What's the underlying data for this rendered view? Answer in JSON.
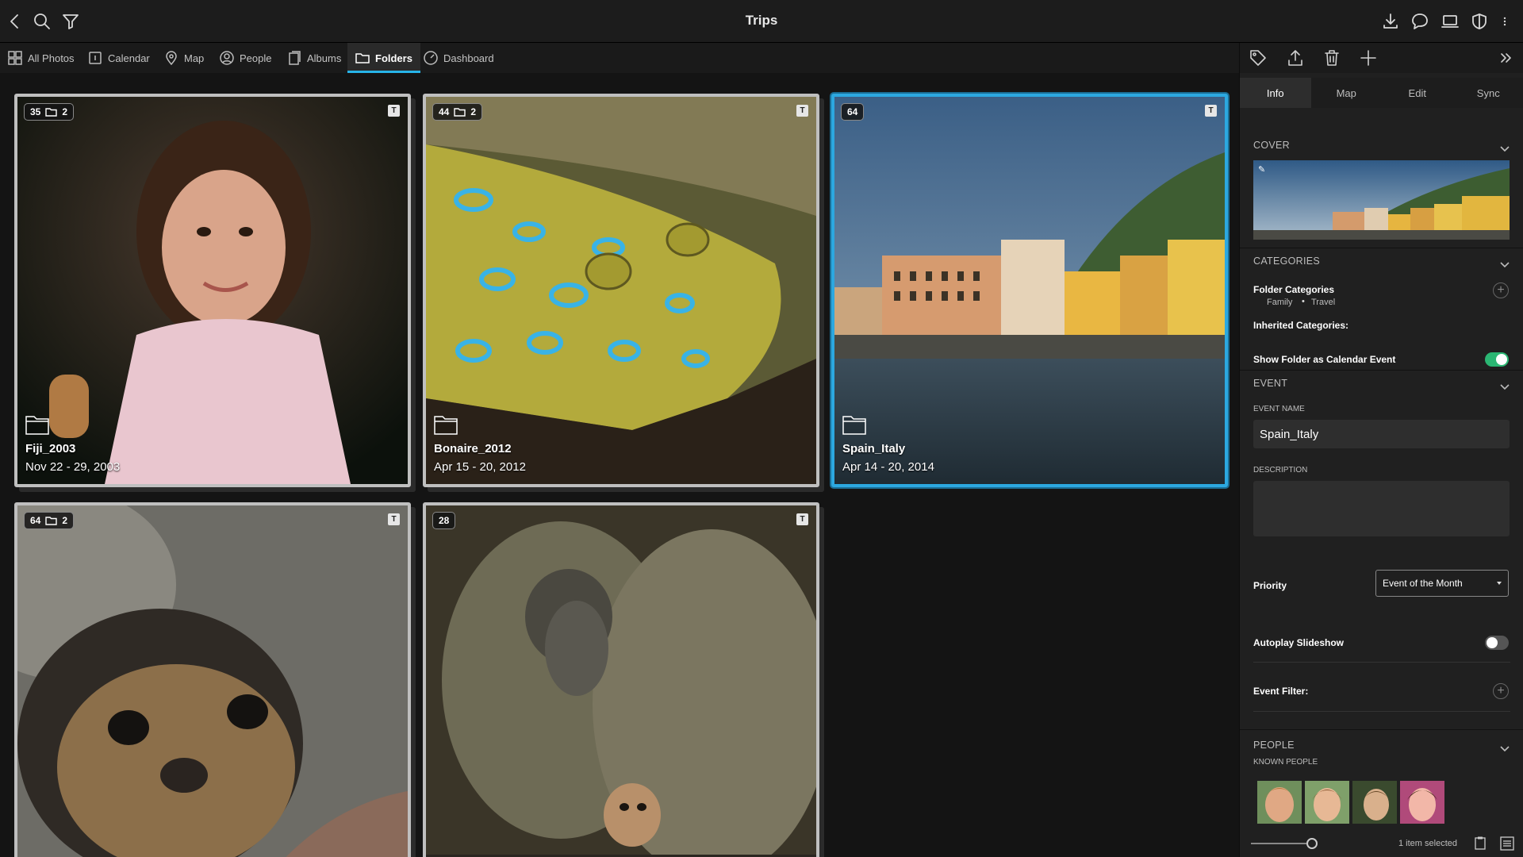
{
  "window": {
    "title": "Trips"
  },
  "nav": {
    "tabs": [
      {
        "label": "All Photos",
        "icon": "grid-icon"
      },
      {
        "label": "Calendar",
        "icon": "calendar-icon"
      },
      {
        "label": "Map",
        "icon": "map-pin-icon"
      },
      {
        "label": "People",
        "icon": "person-icon"
      },
      {
        "label": "Albums",
        "icon": "album-icon"
      },
      {
        "label": "Folders",
        "icon": "folder-icon",
        "active": true
      },
      {
        "label": "Dashboard",
        "icon": "gauge-icon"
      }
    ]
  },
  "folders": [
    {
      "name": "Fiji_2003",
      "dates": "Nov 22 - 29, 2003",
      "count": "35",
      "subfolders": "2",
      "selected": false
    },
    {
      "name": "Bonaire_2012",
      "dates": "Apr 15 - 20, 2012",
      "count": "44",
      "subfolders": "2",
      "selected": false
    },
    {
      "name": "Spain_Italy",
      "dates": "Apr 14 - 20, 2014",
      "count": "64",
      "subfolders": "",
      "selected": true
    },
    {
      "name": "",
      "dates": "",
      "count": "64",
      "subfolders": "2",
      "selected": false
    },
    {
      "name": "",
      "dates": "",
      "count": "28",
      "subfolders": "",
      "selected": false
    }
  ],
  "tile_badge": "T",
  "panel": {
    "tabs": [
      {
        "label": "Info",
        "active": true
      },
      {
        "label": "Map"
      },
      {
        "label": "Edit"
      },
      {
        "label": "Sync"
      }
    ],
    "cover_header": "COVER",
    "categories_header": "CATEGORIES",
    "folder_categories_label": "Folder Categories",
    "folder_categories_values": [
      "Family",
      "Travel"
    ],
    "inherited_categories_label": "Inherited Categories:",
    "show_calendar_label": "Show Folder as Calendar Event",
    "show_calendar_on": true,
    "event_header": "EVENT",
    "event_name_label": "EVENT NAME",
    "event_name_value": "Spain_Italy",
    "description_label": "DESCRIPTION",
    "description_value": "",
    "priority_label": "Priority",
    "priority_value": "Event of the Month",
    "autoplay_label": "Autoplay Slideshow",
    "autoplay_on": false,
    "event_filter_label": "Event Filter:",
    "people_header": "PEOPLE",
    "known_people_label": "KNOWN PEOPLE",
    "status": "1 item selected"
  },
  "colors": {
    "accent": "#27b4e8",
    "toggle_on": "#2bb673",
    "background": "#141414"
  }
}
